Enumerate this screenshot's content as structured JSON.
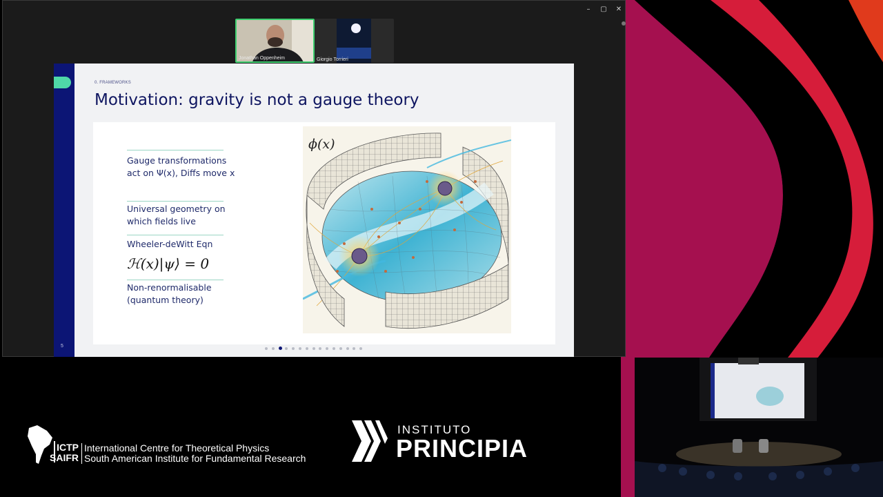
{
  "window": {
    "controls": {
      "minimize": "–",
      "maximize": "▢",
      "close": "✕"
    }
  },
  "participants": [
    {
      "name": "Jonathan Oppenheim"
    },
    {
      "name": "Giorgio Torrieri"
    }
  ],
  "slide": {
    "section": "0. FRAMEWORKS",
    "title": "Motivation: gravity is not a gauge theory",
    "points": [
      {
        "line1": "Gauge transformations",
        "line2": "act on Ψ(x), Diffs move x"
      },
      {
        "line1": "Universal geometry on",
        "line2": "which fields live"
      },
      {
        "line1": "Wheeler-deWitt Eqn",
        "line2": ""
      },
      {
        "line1": "Non-renormalisable",
        "line2": "(quantum theory)"
      }
    ],
    "equation": "ℋ(x)|ψ⟩ = 0",
    "illustration_label": "ϕ(x)",
    "page_number": "5",
    "progress": {
      "total": 15,
      "current": 3
    }
  },
  "logos": {
    "ictp_line1_abbr": "ICTP",
    "ictp_line1_text": "International Centre for Theoretical Physics",
    "ictp_line2_abbr": "SAIFR",
    "ictp_line2_text": "South American Institute for Fundamental Research",
    "principia_top": "INSTITUTO",
    "principia_main": "PRINCIPIA"
  },
  "colors": {
    "slide_navy": "#0c1575",
    "slide_accent": "#4fd8a8",
    "wave_magenta": "#b0125e",
    "wave_red": "#e11f26"
  }
}
